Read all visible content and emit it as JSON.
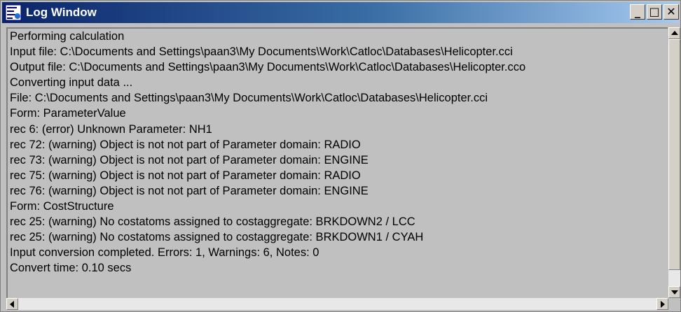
{
  "window": {
    "title": "Log Window",
    "minimize_label": "_",
    "maximize_label": "□",
    "close_label": "✕"
  },
  "log": {
    "lines": [
      "Performing calculation",
      "Input file: C:\\Documents and Settings\\paan3\\My Documents\\Work\\Catloc\\Databases\\Helicopter.cci",
      "Output file: C:\\Documents and Settings\\paan3\\My Documents\\Work\\Catloc\\Databases\\Helicopter.cco",
      "Converting input data ...",
      "File: C:\\Documents and Settings\\paan3\\My Documents\\Work\\Catloc\\Databases\\Helicopter.cci",
      "Form: ParameterValue",
      "rec 6: (error) Unknown Parameter: NH1",
      "rec 72: (warning) Object is not not part of Parameter domain: RADIO",
      "rec 73: (warning) Object is not not part of Parameter domain: ENGINE",
      "rec 75: (warning) Object is not not part of Parameter domain: RADIO",
      "rec 76: (warning) Object is not not part of Parameter domain: ENGINE",
      "Form: CostStructure",
      "rec 25: (warning) No costatoms assigned to costaggregate: BRKDOWN2 / LCC",
      "rec 25: (warning) No costatoms assigned to costaggregate: BRKDOWN1 / CYAH",
      "Input conversion completed. Errors: 1, Warnings: 6, Notes: 0",
      "Convert time: 0.10 secs"
    ]
  },
  "icons": {
    "app": "log-window-icon",
    "minimize": "minimize-icon",
    "maximize": "maximize-icon",
    "close": "close-icon"
  },
  "colors": {
    "titlebar_start": "#0a246a",
    "titlebar_end": "#a6caf0",
    "window_bg": "#c0c0c0"
  }
}
